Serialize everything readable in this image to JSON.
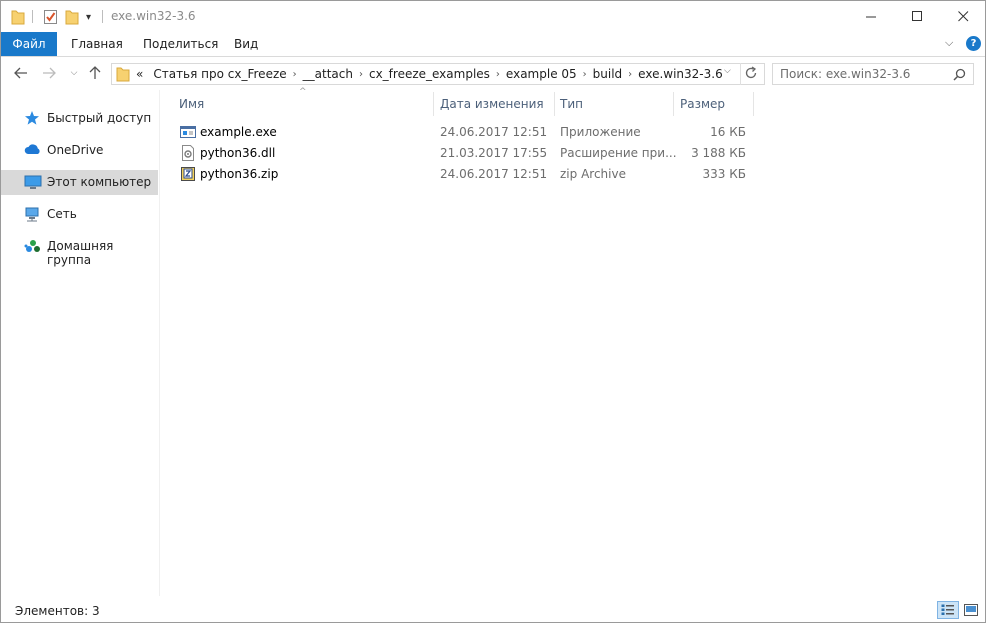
{
  "window": {
    "title": "exe.win32-3.6",
    "minimize_icon": "minimize-icon",
    "maximize_icon": "maximize-icon",
    "close_icon": "close-icon"
  },
  "ribbon": {
    "tabs": [
      {
        "label": "Файл"
      },
      {
        "label": "Главная"
      },
      {
        "label": "Поделиться"
      },
      {
        "label": "Вид"
      }
    ],
    "accent_color": "#1979ca",
    "help_label": "?"
  },
  "address": {
    "overflow": "«",
    "crumbs": [
      "Статья про cx_Freeze",
      "__attach",
      "cx_freeze_examples",
      "example 05",
      "build",
      "exe.win32-3.6"
    ]
  },
  "search": {
    "placeholder": "Поиск: exe.win32-3.6"
  },
  "sidebar": {
    "items": [
      {
        "label": "Быстрый доступ",
        "icon": "star-icon"
      },
      {
        "label": "OneDrive",
        "icon": "cloud-icon"
      },
      {
        "label": "Этот компьютер",
        "icon": "computer-icon",
        "selected": true
      },
      {
        "label": "Сеть",
        "icon": "network-icon"
      },
      {
        "label": "Домашняя группа",
        "icon": "homegroup-icon"
      }
    ]
  },
  "columns": {
    "name": "Имя",
    "date": "Дата изменения",
    "type": "Тип",
    "size": "Размер"
  },
  "files": [
    {
      "name": "example.exe",
      "date": "24.06.2017 12:51",
      "type": "Приложение",
      "size": "16 КБ",
      "icon": "exe-icon"
    },
    {
      "name": "python36.dll",
      "date": "21.03.2017 17:55",
      "type": "Расширение при...",
      "size": "3 188 КБ",
      "icon": "dll-icon"
    },
    {
      "name": "python36.zip",
      "date": "24.06.2017 12:51",
      "type": "zip Archive",
      "size": "333 КБ",
      "icon": "zip-icon"
    }
  ],
  "status": {
    "items_text": "Элементов: 3"
  }
}
